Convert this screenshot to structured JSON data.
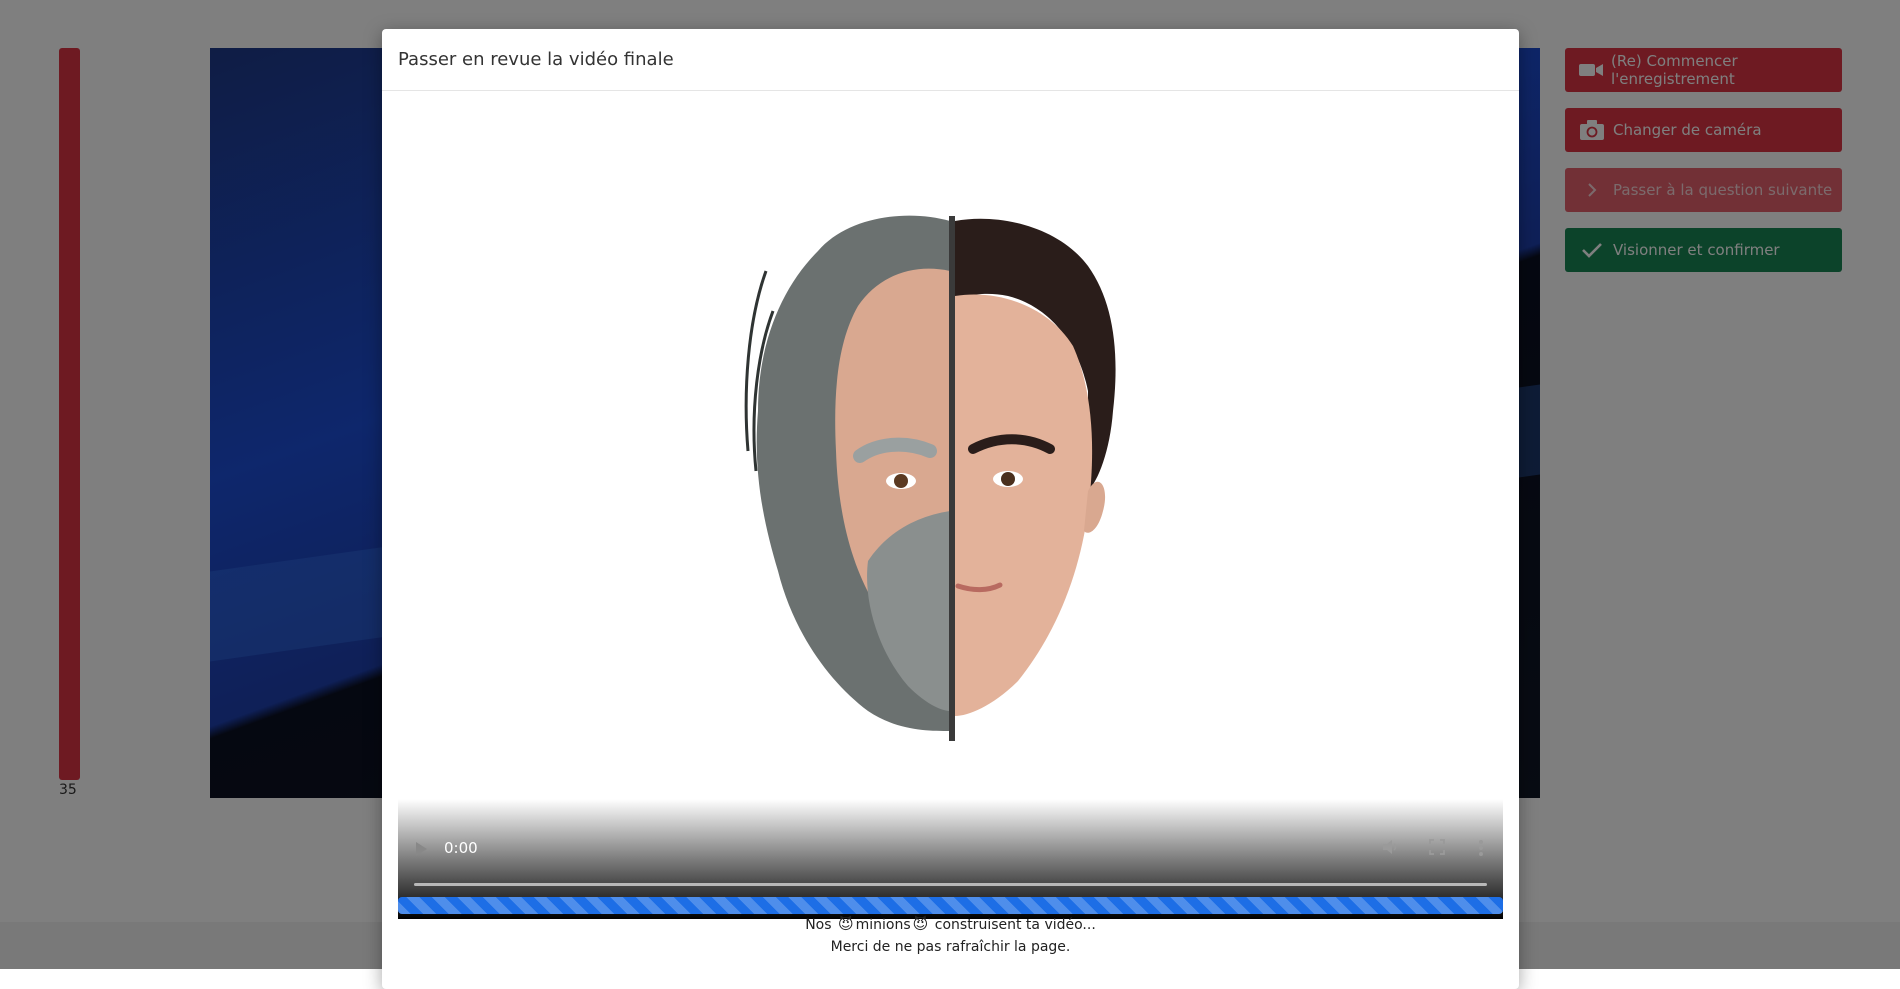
{
  "background": {
    "timer_value": "35",
    "buttons": {
      "record": "(Re) Commencer l'enregistrement",
      "camera": "Changer de caméra",
      "next": "Passer à la question suivante",
      "confirm": "Visionner et confirmer"
    },
    "icons": {
      "record": "video-camera-icon",
      "camera": "switch-camera-icon",
      "next": "chevron-right-icon",
      "confirm": "check-icon"
    },
    "colors": {
      "danger": "#dc3545",
      "danger_disabled": "#e4606d",
      "success": "#198754"
    }
  },
  "modal": {
    "title": "Passer en revue la vidéo finale",
    "video": {
      "current_time": "0:00",
      "controls": [
        "play-icon",
        "volume-icon",
        "fullscreen-icon",
        "more-options-icon"
      ]
    },
    "progress": {
      "color": "#1d6ee6",
      "animated_striped": true
    },
    "status": {
      "line1_part1": "Nos",
      "line1_part2": "minions",
      "line1_part3": "construisent ta vidéo...",
      "line2": "Merci de ne pas rafraîchir la page."
    }
  }
}
